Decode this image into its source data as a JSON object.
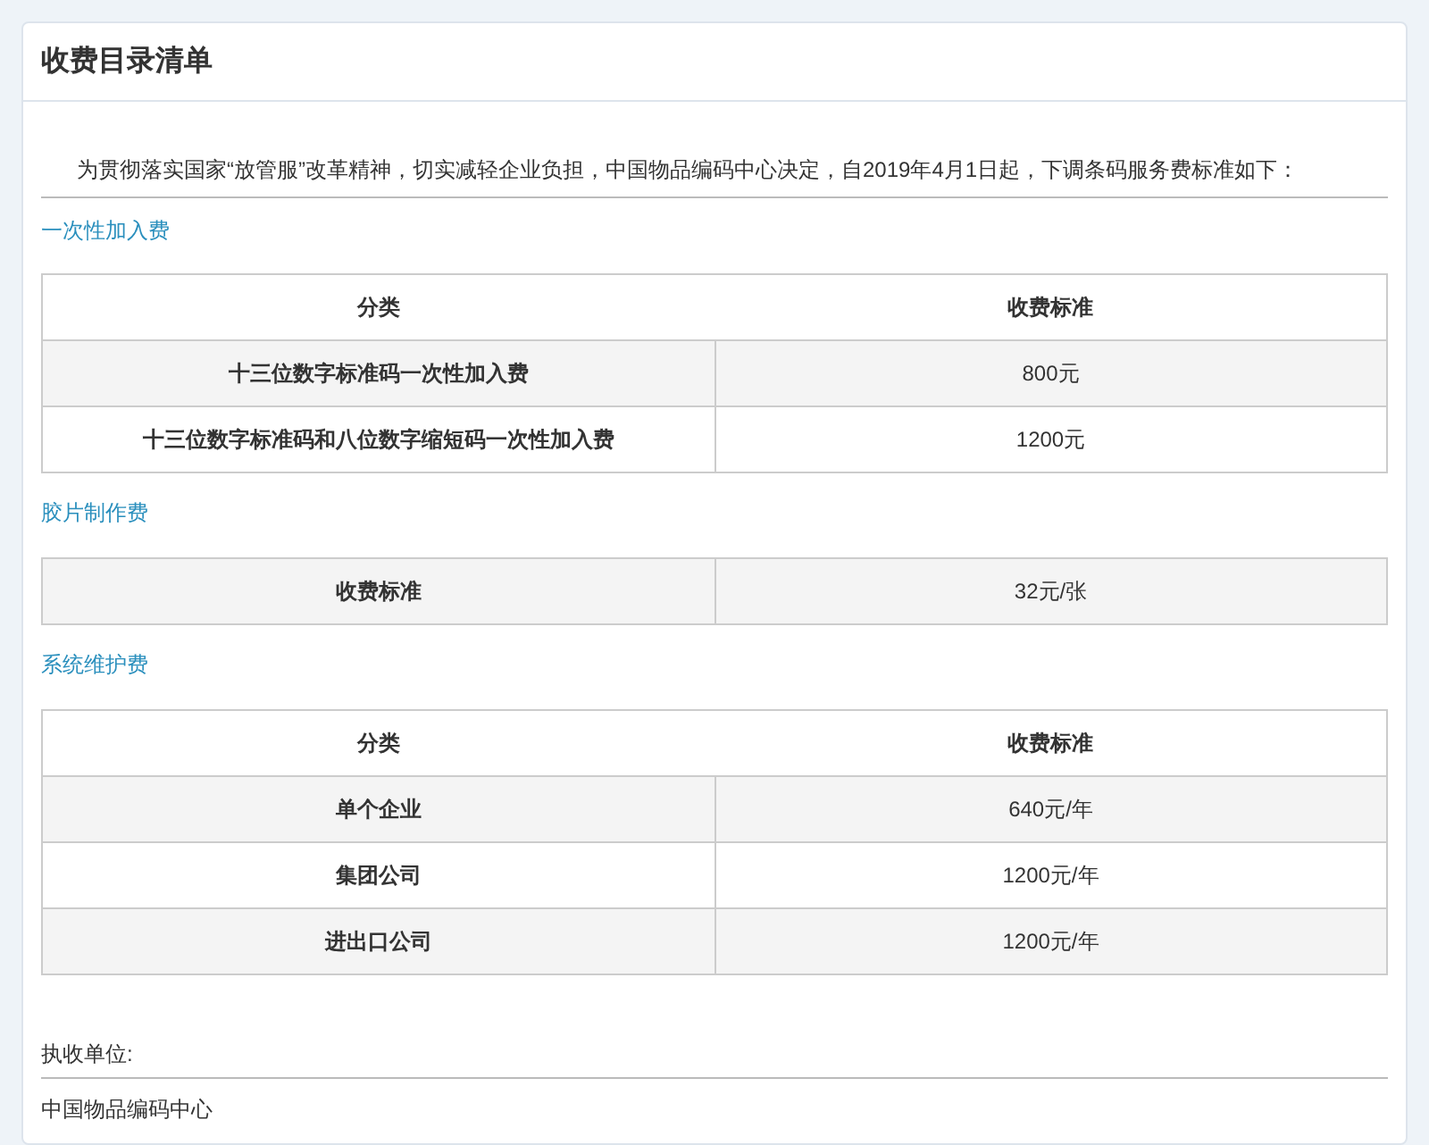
{
  "panel": {
    "title": "收费目录清单"
  },
  "intro": "为贯彻落实国家“放管服”改革精神，切实减轻企业负担，中国物品编码中心决定，自2019年4月1日起，下调条码服务费标准如下：",
  "sections": [
    {
      "label": "一次性加入费",
      "columns": [
        "分类",
        "收费标准"
      ],
      "rows": [
        [
          "十三位数字标准码一次性加入费",
          "800元"
        ],
        [
          "十三位数字标准码和八位数字缩短码一次性加入费",
          "1200元"
        ]
      ]
    },
    {
      "label": "胶片制作费",
      "rows": [
        [
          "收费标准",
          "32元/张"
        ]
      ]
    },
    {
      "label": "系统维护费",
      "columns": [
        "分类",
        "收费标准"
      ],
      "rows": [
        [
          "单个企业",
          "640元/年"
        ],
        [
          "集团公司",
          "1200元/年"
        ],
        [
          "进出口公司",
          "1200元/年"
        ]
      ]
    }
  ],
  "footer": {
    "label": "执收单位:",
    "value": "中国物品编码中心"
  }
}
